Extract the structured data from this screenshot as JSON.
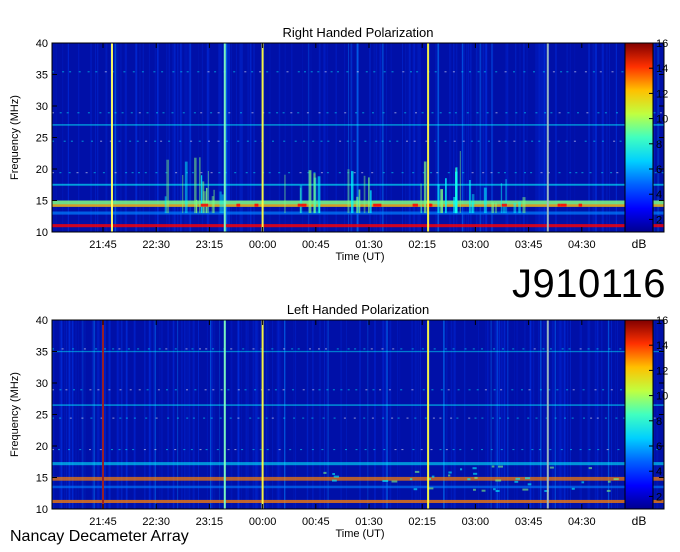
{
  "observation_id": "J910116",
  "footer": "Nancay Decameter Array",
  "palette": [
    "#00008f",
    "#0000ff",
    "#0080ff",
    "#00ffff",
    "#80ff80",
    "#ffff00",
    "#ff8000",
    "#ff0000",
    "#800000"
  ],
  "chart_data": [
    {
      "type": "heatmap",
      "title": "Right Handed Polarization",
      "xlabel": "Time (UT)",
      "ylabel": "Frequency (MHz)",
      "colorbar_label": "dB",
      "x_ticks": [
        "21:45",
        "22:30",
        "23:15",
        "00:00",
        "00:45",
        "01:30",
        "02:15",
        "03:00",
        "03:45",
        "04:30"
      ],
      "y_ticks": [
        10,
        15,
        20,
        25,
        30,
        35,
        40
      ],
      "ylim": [
        10,
        40
      ],
      "colorbar_ticks": [
        2,
        4,
        6,
        8,
        10,
        12,
        14,
        16
      ],
      "colorbar_range": [
        1,
        16
      ],
      "vertical_lines": [
        {
          "time_index": 0.17,
          "color": "#ffff60"
        },
        {
          "time_index": 2.29,
          "color": "#80ffc0"
        },
        {
          "time_index": 3.0,
          "color": "#ffff40"
        },
        {
          "time_index": 6.11,
          "color": "#ffff40"
        },
        {
          "time_index": 8.36,
          "color": "#a0c0c0"
        }
      ]
    },
    {
      "type": "heatmap",
      "title": "Left Handed Polarization",
      "xlabel": "Time (UT)",
      "ylabel": "Frequency (MHz)",
      "colorbar_label": "dB",
      "x_ticks": [
        "21:45",
        "22:30",
        "23:15",
        "00:00",
        "00:45",
        "01:30",
        "02:15",
        "03:00",
        "03:45",
        "04:30"
      ],
      "y_ticks": [
        10,
        15,
        20,
        25,
        30,
        35,
        40
      ],
      "ylim": [
        10,
        40
      ],
      "colorbar_ticks": [
        2,
        4,
        6,
        8,
        10,
        12,
        14,
        16
      ],
      "colorbar_range": [
        1,
        16
      ],
      "vertical_lines": [
        {
          "time_index": 0.0,
          "color": "#a02020"
        },
        {
          "time_index": 2.29,
          "color": "#80ffc0"
        },
        {
          "time_index": 3.0,
          "color": "#ffff40"
        },
        {
          "time_index": 6.11,
          "color": "#ffff40"
        },
        {
          "time_index": 8.36,
          "color": "#a0c0c0"
        }
      ]
    }
  ]
}
